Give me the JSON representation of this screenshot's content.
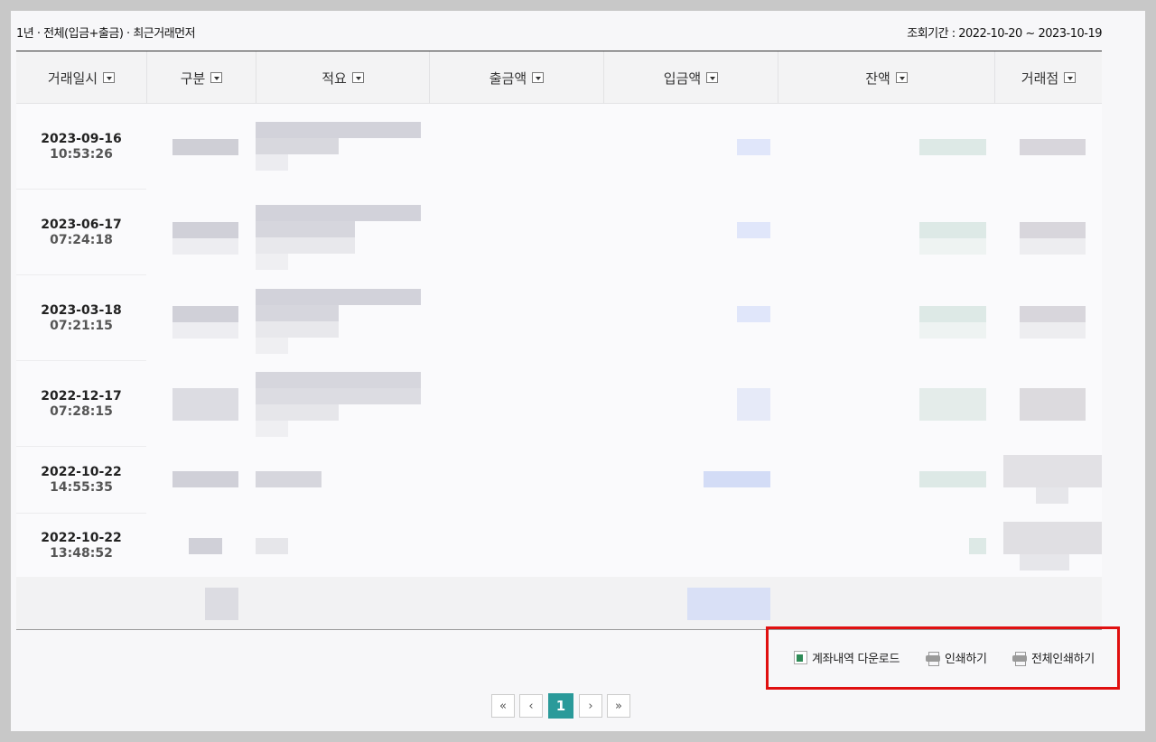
{
  "summary": "1년 · 전체(입금+출금) · 최근거래먼저",
  "period": "조회기간 : 2022-10-20 ~ 2023-10-19",
  "columns": [
    "거래일시",
    "구분",
    "적요",
    "출금액",
    "입금액",
    "잔액",
    "거래점"
  ],
  "rows": [
    {
      "date": "2023-09-16",
      "time": "10:53:26"
    },
    {
      "date": "2023-06-17",
      "time": "07:24:18"
    },
    {
      "date": "2023-03-18",
      "time": "07:21:15"
    },
    {
      "date": "2022-12-17",
      "time": "07:28:15"
    },
    {
      "date": "2022-10-22",
      "time": "14:55:35"
    },
    {
      "date": "2022-10-22",
      "time": "13:48:52"
    }
  ],
  "actions": {
    "download": "계좌내역 다운로드",
    "print": "인쇄하기",
    "print_all": "전체인쇄하기"
  },
  "pagination": {
    "first": "«",
    "prev": "‹",
    "current": "1",
    "next": "›",
    "last": "»"
  },
  "colors": {
    "accent": "#2a9a9a",
    "highlight_border": "#e01010"
  }
}
